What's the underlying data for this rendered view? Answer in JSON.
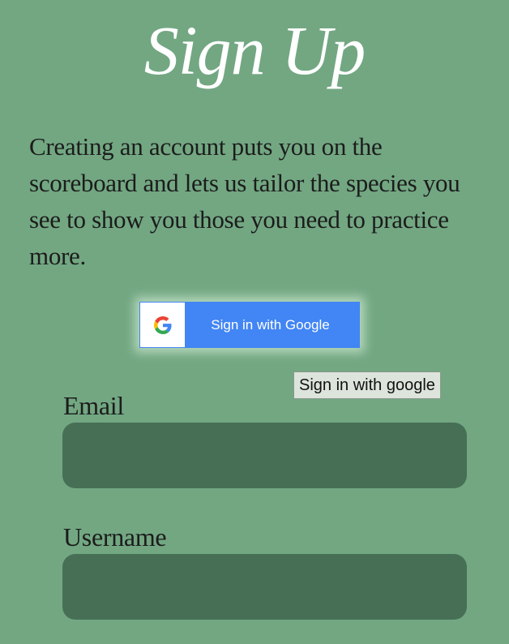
{
  "page": {
    "title": "Sign Up",
    "intro": "Creating an account puts you on the scoreboard and lets us tailor the species you see to show you those you need to practice more."
  },
  "google_signin": {
    "label": "Sign in with Google",
    "icon": "google-g-icon",
    "tooltip": "Sign in with google"
  },
  "form": {
    "email_label": "Email",
    "email_value": "",
    "username_label": "Username",
    "username_value": ""
  },
  "colors": {
    "background": "#72a782",
    "input_background": "#476f56",
    "google_blue": "#4285f4",
    "title_color": "#ffffff"
  }
}
